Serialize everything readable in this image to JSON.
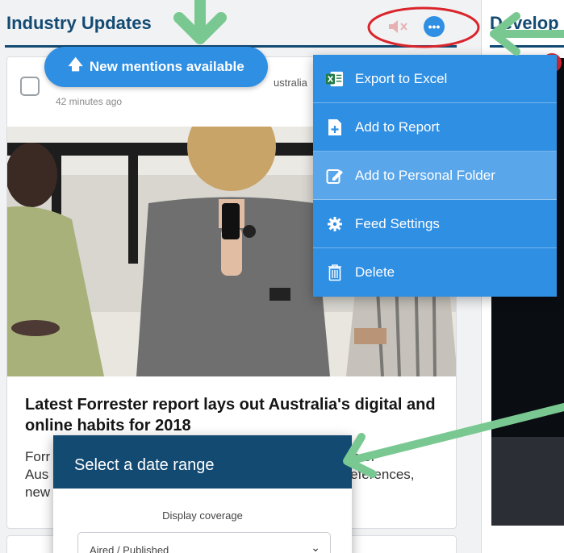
{
  "feed": {
    "title": "Industry Updates"
  },
  "right_feed": {
    "title": "Develop"
  },
  "header": {
    "bell_icon": "speaker-mute-icon",
    "more_icon": "ellipsis-icon",
    "more_label": "•••"
  },
  "new_mentions": {
    "label": "New mentions available",
    "icon": "arrow-up-icon"
  },
  "card": {
    "source": "ustralia",
    "time": "42 minutes ago",
    "headline": "Latest Forrester report lays out Australia's digital and online habits for 2018",
    "snippet_lines": [
      "Forr",
      "Aus",
      "new"
    ],
    "snippet_right": [
      "s of",
      "preferences,"
    ]
  },
  "menu": {
    "items": [
      {
        "label": "Export to Excel",
        "icon": "excel-icon"
      },
      {
        "label": "Add to Report",
        "icon": "add-report-icon"
      },
      {
        "label": "Add to Personal Folder",
        "icon": "edit-folder-icon"
      },
      {
        "label": "Feed Settings",
        "icon": "gear-icon"
      },
      {
        "label": "Delete",
        "icon": "trash-icon"
      }
    ]
  },
  "date_modal": {
    "title": "Select a date range",
    "display_label": "Display coverage",
    "select_value": "Aired / Published"
  },
  "colors": {
    "brand_dark": "#134a72",
    "accent": "#2f8fe3",
    "annotation_green": "#7ac891",
    "annotation_red": "#d9252b"
  }
}
